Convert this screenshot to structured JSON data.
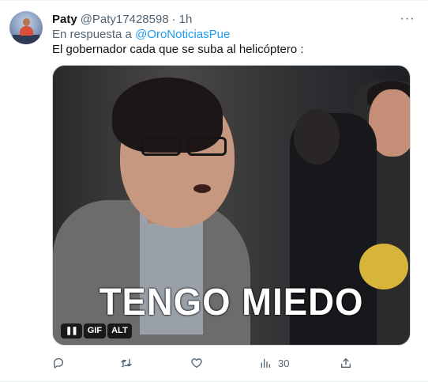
{
  "tweet": {
    "author_name": "Paty",
    "handle": "@Paty17428598",
    "separator": "·",
    "time": "1h",
    "reply_prefix": "En respuesta a",
    "reply_to": "@OroNoticiasPue",
    "text": "El gobernador cada que se suba al helicóptero :",
    "more_label": "···"
  },
  "media": {
    "caption": "TENGO MIEDO",
    "pause_label": "❚❚",
    "gif_label": "GIF",
    "alt_label": "ALT"
  },
  "actions": {
    "reply_icon": "reply-icon",
    "retweet_icon": "retweet-icon",
    "like_icon": "heart-icon",
    "views_icon": "views-icon",
    "views_count": "30",
    "share_icon": "share-icon"
  },
  "colors": {
    "link": "#1d9bf0",
    "secondary_text": "#536471",
    "primary_text": "#0f1419"
  }
}
